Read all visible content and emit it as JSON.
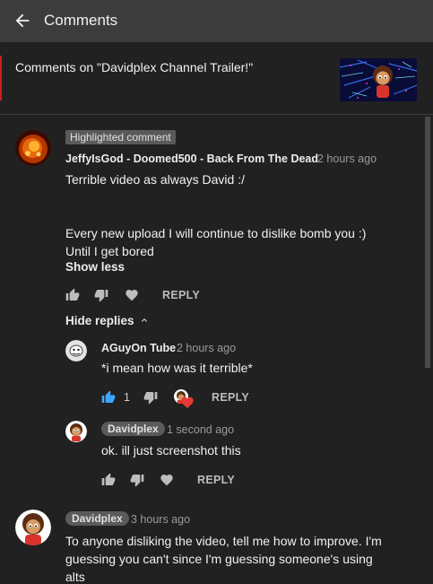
{
  "topbar": {
    "title": "Comments"
  },
  "header": {
    "title": "Comments on \"Davidplex Channel Trailer!\""
  },
  "comments": [
    {
      "badge": "Highlighted comment",
      "author": "JeffyIsGod - Doomed500 - Back From The Dead",
      "time": "2 hours ago",
      "line1": "Terrible video as always David :/",
      "line2": "Every new upload I will continue to dislike bomb you :)",
      "line3": "Until I get bored",
      "show_less": "Show less",
      "reply": "REPLY",
      "hide_replies": "Hide replies"
    },
    {
      "author": "Davidplex",
      "time": "3 hours ago",
      "line1": "To anyone disliking the video, tell me how to improve. I'm",
      "line2": "guessing you can't since I'm guessing someone's using",
      "line3": "alts"
    }
  ],
  "replies": [
    {
      "author": "AGuyOn Tube",
      "time": "2 hours ago",
      "text": "*i mean how was it terrible*",
      "like_count": "1",
      "like_color": "#3ea6ff",
      "heart_color": "#e53935",
      "reply": "REPLY"
    },
    {
      "author": "Davidplex",
      "time": "1 second ago",
      "text": "ok. ill just screenshot this",
      "reply": "REPLY"
    }
  ],
  "icons": {
    "back": "arrow-left-icon",
    "like": "thumbs-up-icon",
    "dislike": "thumbs-down-icon",
    "heart": "heart-icon",
    "chevron": "chevron-up-icon"
  }
}
